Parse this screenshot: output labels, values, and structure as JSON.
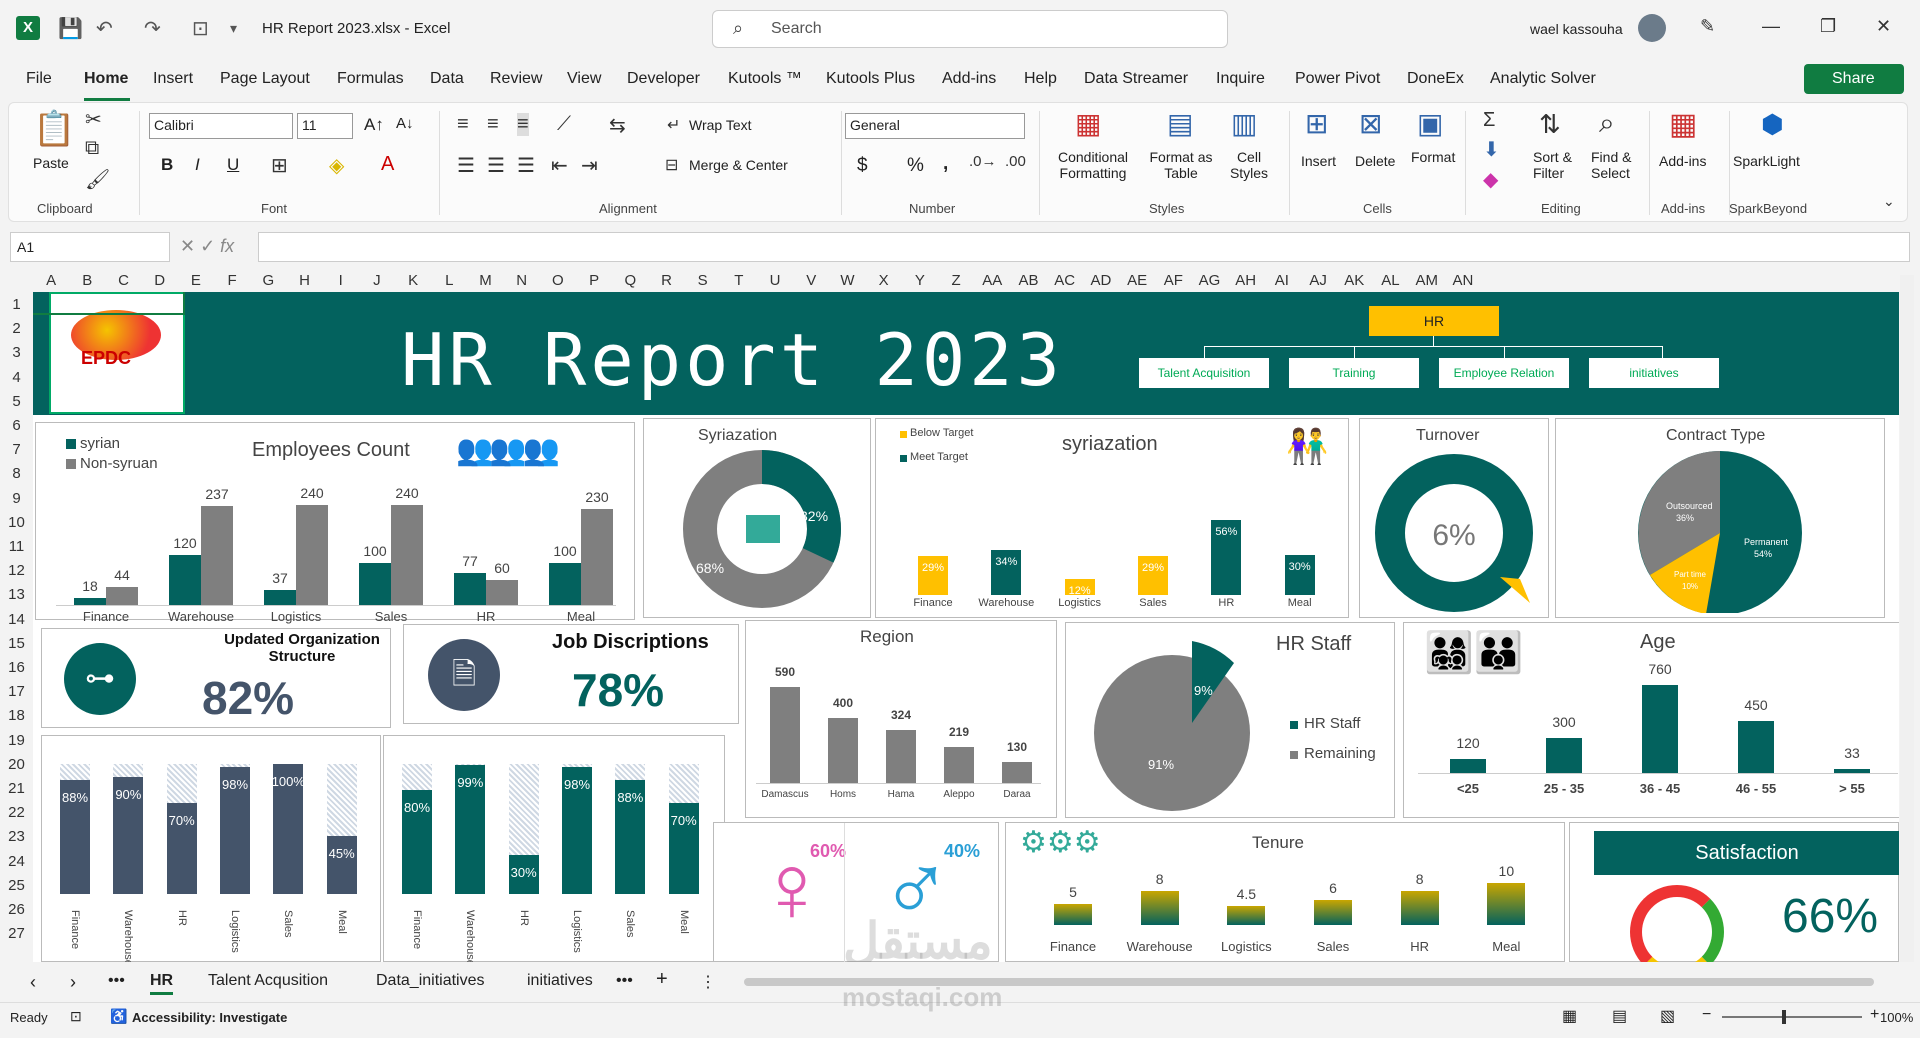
{
  "titlebar": {
    "app_letter": "X",
    "doc_title": "HR Report 2023.xlsx  -  Excel",
    "search_placeholder": "Search",
    "user_name": "wael kassouha"
  },
  "menu_tabs": [
    "File",
    "Home",
    "Insert",
    "Page Layout",
    "Formulas",
    "Data",
    "Review",
    "View",
    "Developer",
    "Kutools ™",
    "Kutools Plus",
    "Add-ins",
    "Help",
    "Data Streamer",
    "Inquire",
    "Power Pivot",
    "DoneEx",
    "Analytic Solver"
  ],
  "share_label": "Share",
  "ribbon": {
    "clipboard": {
      "paste": "Paste",
      "group": "Clipboard"
    },
    "font": {
      "name": "Calibri",
      "size": "11",
      "group": "Font",
      "bold": "B",
      "italic": "I",
      "underline": "U"
    },
    "alignment": {
      "wrap": "Wrap Text",
      "merge": "Merge & Center",
      "group": "Alignment"
    },
    "number": {
      "format": "General",
      "group": "Number",
      "dollar": "$",
      "percent": "%",
      "comma": ","
    },
    "styles": {
      "cond1": "Conditional",
      "cond2": "Formatting",
      "fmt1": "Format as",
      "fmt2": "Table",
      "cell1": "Cell",
      "cell2": "Styles",
      "group": "Styles"
    },
    "cells": {
      "insert": "Insert",
      "delete": "Delete",
      "format": "Format",
      "group": "Cells"
    },
    "editing": {
      "sort1": "Sort &",
      "sort2": "Filter",
      "find1": "Find &",
      "find2": "Select",
      "group": "Editing"
    },
    "addins": {
      "label": "Add-ins",
      "group": "Add-ins"
    },
    "spark": {
      "label": "SparkLight",
      "group": "SparkBeyond"
    }
  },
  "namebox": "A1",
  "columns": [
    "A",
    "B",
    "C",
    "D",
    "E",
    "F",
    "G",
    "H",
    "I",
    "J",
    "K",
    "L",
    "M",
    "N",
    "O",
    "P",
    "Q",
    "R",
    "S",
    "T",
    "U",
    "V",
    "W",
    "X",
    "Y",
    "Z",
    "AA",
    "AB",
    "AC",
    "AD",
    "AE",
    "AF",
    "AG",
    "AH",
    "AI",
    "AJ",
    "AK",
    "AL",
    "AM",
    "AN"
  ],
  "rows": [
    "1",
    "2",
    "3",
    "4",
    "5",
    "6",
    "7",
    "8",
    "9",
    "10",
    "11",
    "12",
    "13",
    "14",
    "15",
    "16",
    "17",
    "18",
    "19",
    "20",
    "21",
    "22",
    "23",
    "24",
    "25",
    "26",
    "27"
  ],
  "dashboard": {
    "title": "HR Report 2023",
    "logo_text": "EPDC",
    "hr_tree": {
      "root": "HR",
      "children": [
        "Talent Acquisition",
        "Training",
        "Employee Relation",
        "initiatives"
      ]
    },
    "employees": {
      "title": "Employees Count",
      "legend": [
        "syrian",
        "Non-syruan"
      ],
      "categories": [
        "Finance",
        "Warehouse",
        "Logistics",
        "Sales",
        "HR",
        "Meal"
      ],
      "syrian": [
        18,
        120,
        37,
        100,
        77,
        100
      ],
      "non_syrian": [
        44,
        237,
        240,
        240,
        60,
        230
      ]
    },
    "syriazation_donut": {
      "title": "Syriazation",
      "a": "32%",
      "b": "68%",
      "value": 32
    },
    "syriazation_bar": {
      "title": "syriazation",
      "legend": [
        "Below Target",
        "Meet Target"
      ],
      "categories": [
        "Finance",
        "Warehouse",
        "Logistics",
        "Sales",
        "HR",
        "Meal"
      ],
      "values": [
        29,
        34,
        12,
        29,
        56,
        30
      ],
      "labels": [
        "29%",
        "34%",
        "12%",
        "29%",
        "56%",
        "30%"
      ],
      "meet": [
        false,
        true,
        false,
        false,
        true,
        true
      ]
    },
    "turnover": {
      "title": "Turnover",
      "value": "6%"
    },
    "contract": {
      "title": "Contract Type",
      "outsourced": "Outsourced",
      "outsourced_pct": "36%",
      "permanent": "Permanent",
      "permanent_pct": "54%",
      "part": "Part time",
      "part_pct": "10%"
    },
    "org": {
      "title1": "Updated Organization",
      "title2": "Structure",
      "value": "82%"
    },
    "job": {
      "title": "Job Discriptions",
      "value": "78%"
    },
    "region": {
      "title": "Region",
      "categories": [
        "Damascus",
        "Homs",
        "Hama",
        "Aleppo",
        "Daraa"
      ],
      "values": [
        590,
        400,
        324,
        219,
        130
      ]
    },
    "hrstaff": {
      "title": "HR Staff",
      "legend": [
        "HR Staff",
        "Remaining"
      ],
      "staff": "9%",
      "rest": "91%"
    },
    "age": {
      "title": "Age",
      "categories": [
        "<25",
        "25 - 35",
        "36 - 45",
        "46 - 55",
        "> 55"
      ],
      "values": [
        120,
        300,
        760,
        450,
        33
      ]
    },
    "progress1": {
      "categories": [
        "Finance",
        "Warehouse",
        "HR",
        "Logistics",
        "Sales",
        "Meal"
      ],
      "values": [
        88,
        90,
        70,
        98,
        100,
        45
      ],
      "labels": [
        "88%",
        "90%",
        "70%",
        "98%",
        "100%",
        "45%"
      ]
    },
    "progress2": {
      "categories": [
        "Finance",
        "Warehouse",
        "HR",
        "Logistics",
        "Sales",
        "Meal"
      ],
      "values": [
        80,
        99,
        30,
        98,
        88,
        70
      ],
      "labels": [
        "80%",
        "99%",
        "30%",
        "98%",
        "88%",
        "70%"
      ]
    },
    "gender": {
      "female": "60%",
      "male": "40%"
    },
    "tenure": {
      "title": "Tenure",
      "categories": [
        "Finance",
        "Warehouse",
        "Logistics",
        "Sales",
        "HR",
        "Meal"
      ],
      "values": [
        5,
        8,
        4.5,
        6,
        8,
        10
      ],
      "labels": [
        "5",
        "8",
        "4.5",
        "6",
        "8",
        "10"
      ]
    },
    "satisfaction": {
      "title": "Satisfaction",
      "value": "66%"
    }
  },
  "sheet_tabs": [
    "HR",
    "Talent Acqusition",
    "Data_initiatives",
    "initiatives"
  ],
  "status": {
    "ready": "Ready",
    "access": "Accessibility: Investigate",
    "zoom": "100%"
  },
  "watermark": {
    "ar": "مستقل",
    "en": "mostaqi.com"
  },
  "colors": {
    "teal": "#03625e",
    "gray": "#7f7f7f",
    "navy": "#44546a",
    "yellow": "#ffc000",
    "excel": "#107c41"
  }
}
